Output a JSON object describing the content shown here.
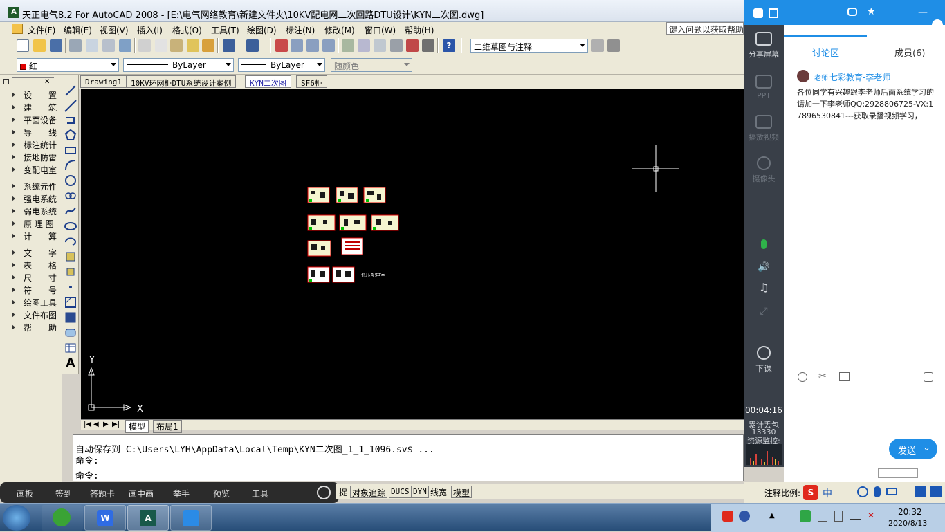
{
  "window": {
    "title": "天正电气8.2 For AutoCAD 2008 - [E:\\电气网络教育\\新建文件夹\\10KV配电网二次回路DTU设计\\KYN二次图.dwg]",
    "help_placeholder": "键入问题以获取帮助"
  },
  "menu": [
    "文件(F)",
    "编辑(E)",
    "视图(V)",
    "插入(I)",
    "格式(O)",
    "工具(T)",
    "绘图(D)",
    "标注(N)",
    "修改(M)",
    "窗口(W)",
    "帮助(H)"
  ],
  "toolbar": {
    "workspace": "二维草图与注释",
    "color": "红",
    "linetype": "ByLayer",
    "lineweight": "ByLayer",
    "plotstyle": "随颜色"
  },
  "left_panel": [
    "设　　置",
    "建　　筑",
    "平面设备",
    "导　　线",
    "标注统计",
    "接地防雷",
    "变配电室",
    "系统元件",
    "强电系统",
    "弱电系统",
    "原 理 图",
    "计　　算",
    "文　　字",
    "表　　格",
    "尺　　寸",
    "符　　号",
    "绘图工具",
    "文件布图",
    "帮　　助"
  ],
  "drawing_tabs": [
    "Drawing1",
    "10KV环网柜DTU系统设计案例",
    "KYN二次图",
    "SF6柜"
  ],
  "active_tab": "KYN二次图",
  "canvas": {
    "ucs_x": "X",
    "ucs_y": "Y",
    "label": "低压配电室"
  },
  "model_tabs": [
    "模型",
    "布局1"
  ],
  "command": {
    "line1": "自动保存到 C:\\Users\\LYH\\AppData\\Local\\Temp\\KYN二次图_1_1_1096.sv$ ...",
    "line2": "命令:",
    "line3": "命令:"
  },
  "bottom_tools": [
    "画板",
    "签到",
    "答题卡",
    "画中画",
    "举手",
    "预览",
    "工具"
  ],
  "status_buttons": [
    "捉",
    "对象追踪",
    "DUCS",
    "DYN",
    "线宽",
    "模型"
  ],
  "annotation_scale": "注释比例:",
  "live": {
    "sidebar": [
      "分享屏幕",
      "PPT",
      "播放视频",
      "摄像头",
      "下课"
    ],
    "timer": "00:04:16",
    "lost_label": "累计丢包",
    "lost_count": "13330",
    "monitor": "资源监控:",
    "tab_discuss": "讨论区",
    "tab_members": "成员(6)",
    "msg_role": "老师",
    "msg_name": "七彩教育-李老师",
    "msg_text": "各位同学有兴趣跟李老师后面系统学习的请加一下李老师QQ:2928806725-VX:17896530841---获取录播视频学习，",
    "send": "发送"
  },
  "ime": {
    "cn": "中"
  },
  "clock": {
    "time": "20:32",
    "date": "2020/8/13"
  },
  "colors": {
    "accent": "#1f8ee6",
    "canvas": "#000000",
    "sidebar": "#393f48"
  }
}
